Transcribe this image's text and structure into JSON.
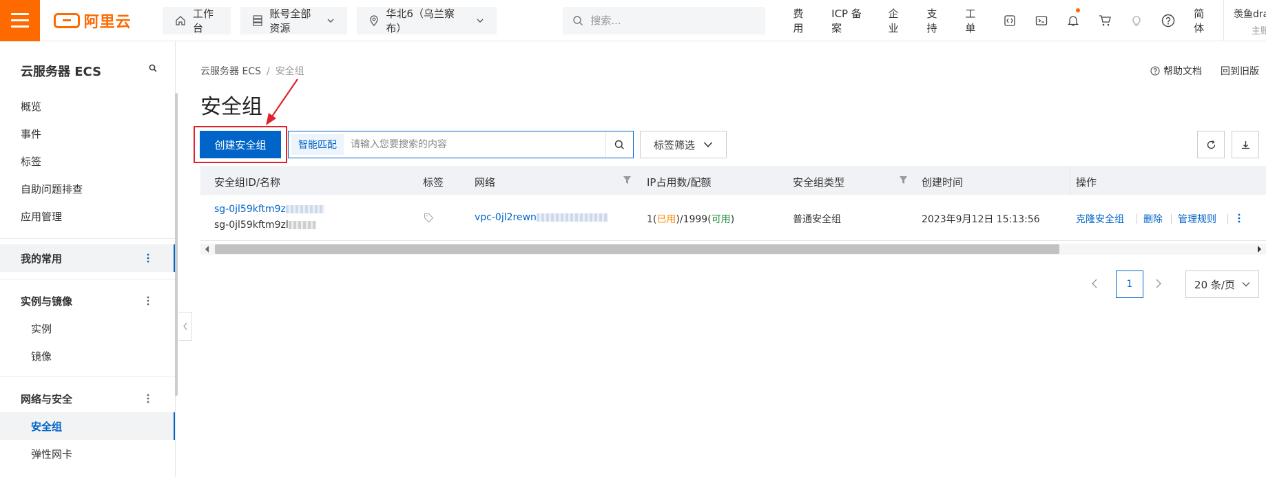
{
  "topbar": {
    "brand": "阿里云",
    "workbench": "工作台",
    "resources": "账号全部资源",
    "region": "华北6（乌兰察布）",
    "search_placeholder": "搜索...",
    "links": [
      "费用",
      "ICP 备案",
      "企业",
      "支持",
      "工单"
    ],
    "lang": "简体",
    "user_name": "羡鱼dra",
    "user_role": "主账"
  },
  "sidebar": {
    "title": "云服务器 ECS",
    "items": [
      "概览",
      "事件",
      "标签",
      "自助问题排查",
      "应用管理"
    ],
    "group_favorites": "我的常用",
    "group_instances": "实例与镜像",
    "instances_items": [
      "实例",
      "镜像"
    ],
    "group_network": "网络与安全",
    "network_items": [
      "安全组",
      "弹性网卡"
    ]
  },
  "breadcrumb": {
    "root": "云服务器 ECS",
    "current": "安全组"
  },
  "header": {
    "help": "帮助文档",
    "old_version": "回到旧版",
    "title": "安全组"
  },
  "toolbar": {
    "create": "创建安全组",
    "match_mode": "智能匹配",
    "search_placeholder": "请输入您要搜索的内容",
    "tag_filter": "标签筛选"
  },
  "table": {
    "columns": [
      "安全组ID/名称",
      "标签",
      "网络",
      "IP占用数/配额",
      "安全组类型",
      "创建时间",
      "操作"
    ],
    "rows": [
      {
        "id": "sg-0jl59kftm9z",
        "name": "sg-0jl59kftm9zl",
        "network": "vpc-0jl2rewn",
        "ip_used": "1",
        "ip_used_label": "已用",
        "ip_quota": "1999",
        "ip_avail_label": "可用",
        "type": "普通安全组",
        "created": "2023年9月12日 15:13:56",
        "actions": [
          "克隆安全组",
          "删除",
          "管理规则"
        ]
      }
    ]
  },
  "pagination": {
    "current": "1",
    "page_size": "20 条/页"
  },
  "colors": {
    "brand": "#ff6a00",
    "primary": "#0064c8",
    "highlight": "#e0202a"
  }
}
